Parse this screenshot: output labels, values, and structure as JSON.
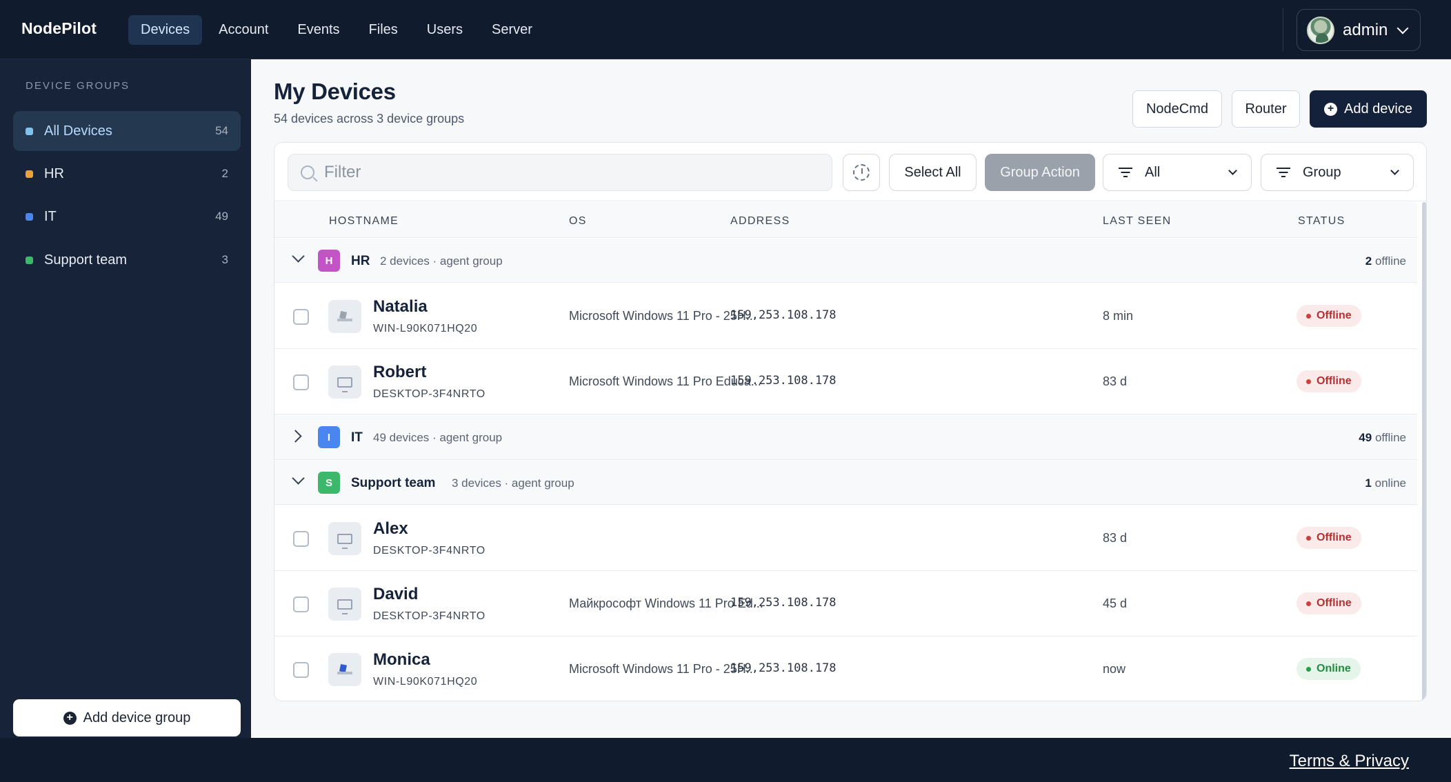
{
  "app": {
    "brand": "NodePilot"
  },
  "nav": {
    "items": [
      {
        "label": "Devices"
      },
      {
        "label": "Account"
      },
      {
        "label": "Events"
      },
      {
        "label": "Files"
      },
      {
        "label": "Users"
      },
      {
        "label": "Server"
      }
    ],
    "active": "Devices",
    "user": "admin"
  },
  "sidebar": {
    "title": "DEVICE GROUPS",
    "groups": [
      {
        "label": "All Devices",
        "count": "54",
        "color": "#7ec3f0"
      },
      {
        "label": "HR",
        "count": "2",
        "color": "#e8a23c"
      },
      {
        "label": "IT",
        "count": "49",
        "color": "#4a86f0"
      },
      {
        "label": "Support team",
        "count": "3",
        "color": "#3cb86b"
      }
    ],
    "add_group_label": "Add device group"
  },
  "header": {
    "title": "My Devices",
    "subtitle": "54 devices across 3 device groups",
    "buttons": {
      "nodecmd": "NodeCmd",
      "router": "Router",
      "add_device": "Add device"
    }
  },
  "toolbar": {
    "filter_placeholder": "Filter",
    "select_all": "Select All",
    "group_action": "Group Action",
    "status_filter": "All",
    "group_by": "Group"
  },
  "table": {
    "columns": [
      "HOSTNAME",
      "OS",
      "ADDRESS",
      "LAST SEEN",
      "STATUS"
    ],
    "groups": [
      {
        "letter": "H",
        "name": "HR",
        "meta": "2 devices · agent group",
        "status_count": "2",
        "status_word": "offline",
        "color": "#c254c6",
        "expanded": true,
        "devices": [
          {
            "name": "Natalia",
            "host": "WIN-L90K071HQ20",
            "os": "Microsoft Windows 11 Pro - 25H...",
            "address": "159.253.108.178",
            "last_seen": "8 min",
            "status": "Offline",
            "icon": "pc-tower-icon"
          },
          {
            "name": "Robert",
            "host": "DESKTOP-3F4NRTO",
            "os": "Microsoft Windows 11 Pro Educa...",
            "address": "159.253.108.178",
            "last_seen": "83 d",
            "status": "Offline",
            "icon": "monitor-icon"
          }
        ]
      },
      {
        "letter": "I",
        "name": "IT",
        "meta": "49 devices · agent group",
        "status_count": "49",
        "status_word": "offline",
        "color": "#4a86f0",
        "expanded": false,
        "devices": []
      },
      {
        "letter": "S",
        "name": "Support team",
        "meta": "3 devices · agent group",
        "status_count": "1",
        "status_word": "online",
        "color": "#3cb86b",
        "expanded": true,
        "devices": [
          {
            "name": "Alex",
            "host": "DESKTOP-3F4NRTO",
            "os": "",
            "address": "",
            "last_seen": "83 d",
            "status": "Offline",
            "icon": "monitor-icon"
          },
          {
            "name": "David",
            "host": "DESKTOP-3F4NRTO",
            "os": "Майкрософт Windows 11 Pro Ed...",
            "address": "159.253.108.178",
            "last_seen": "45 d",
            "status": "Offline",
            "icon": "monitor-icon"
          },
          {
            "name": "Monica",
            "host": "WIN-L90K071HQ20",
            "os": "Microsoft Windows 11 Pro - 25H...",
            "address": "159.253.108.178",
            "last_seen": "now",
            "status": "Online",
            "icon": "pc-tower-blue-icon"
          }
        ]
      }
    ]
  },
  "footer": {
    "terms": "Terms & Privacy"
  }
}
